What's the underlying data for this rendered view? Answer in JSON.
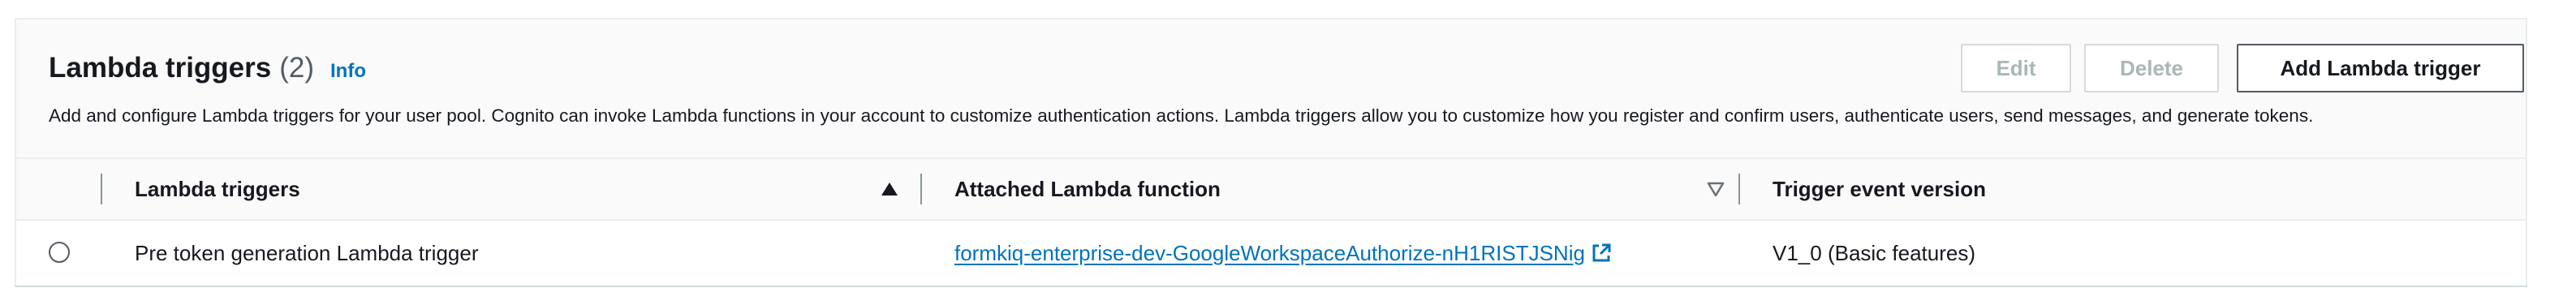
{
  "section": {
    "title": "Lambda triggers",
    "count": "(2)",
    "info_link": "Info",
    "description": "Add and configure Lambda triggers for your user pool. Cognito can invoke Lambda functions in your account to customize authentication actions. Lambda triggers allow you to customize how you register and confirm users, authenticate users, send messages, and generate tokens."
  },
  "buttons": {
    "edit": "Edit",
    "delete": "Delete",
    "add": "Add Lambda trigger"
  },
  "table": {
    "columns": [
      {
        "label": "Lambda triggers",
        "sort": "ascending"
      },
      {
        "label": "Attached Lambda function",
        "sort": "unsorted"
      },
      {
        "label": "Trigger event version"
      }
    ],
    "rows": [
      {
        "selected": false,
        "trigger": "Pre token generation Lambda trigger",
        "function": "formkiq-enterprise-dev-GoogleWorkspaceAuthorize-nH1RISTJSNig",
        "version": "V1_0 (Basic features)"
      }
    ]
  },
  "colors": {
    "link": "#0073bb",
    "text": "#16191f",
    "secondary_text": "#545b64",
    "disabled": "#aab7b8",
    "header_bg": "#fafafa",
    "border": "#eaeded"
  },
  "icons": [
    "sort-ascending-icon",
    "sort-descending-icon",
    "external-link-icon",
    "radio-button"
  ]
}
